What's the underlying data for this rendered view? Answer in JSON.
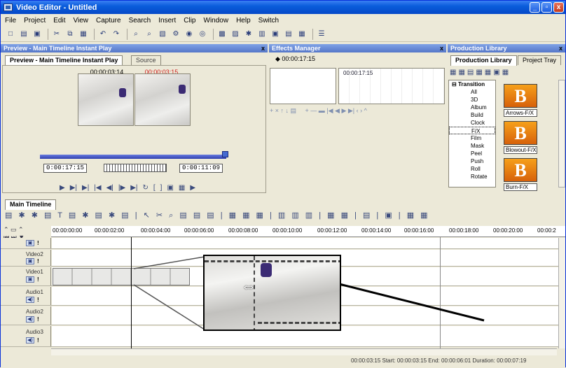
{
  "window": {
    "title": "Video Editor - Untitled",
    "min": "_",
    "max": "▫",
    "close": "x"
  },
  "menu": [
    "File",
    "Project",
    "Edit",
    "View",
    "Capture",
    "Search",
    "Insert",
    "Clip",
    "Window",
    "Help",
    "Switch"
  ],
  "toolbar_icons": [
    "new-icon",
    "open-icon",
    "save-icon",
    "cut-icon",
    "copy-icon",
    "paste-icon",
    "undo-icon",
    "redo-icon",
    "zoom-in-icon",
    "zoom-out-icon",
    "snapshot-icon",
    "settings-icon",
    "record-icon",
    "burn-icon",
    "preview-icon",
    "capture-icon",
    "effects-icon",
    "produce-icon",
    "library-icon",
    "layout-icon",
    "timeline-icon"
  ],
  "preview": {
    "panel_title": "Preview - Main Timeline Instant Play",
    "tab_active": "Preview - Main Timeline Instant Play",
    "tab_source": "Source",
    "time_left": "00:00:03:14",
    "time_right": "00:00:03:15",
    "timecode_in": "0:00:17:15",
    "timecode_out": "0:00:11:09",
    "close": "x"
  },
  "effects": {
    "panel_title": "Effects Manager",
    "time": "00:00:17:15",
    "ruler_time": "00:00:17:15",
    "close": "x"
  },
  "library": {
    "panel_title": "Production Library",
    "tab_active": "Production Library",
    "tab_other": "Project Tray",
    "close": "x",
    "tree_root": "Transition",
    "categories": [
      "All",
      "3D",
      "Album",
      "Build",
      "Clock",
      "F/X",
      "Film",
      "Mask",
      "Peel",
      "Push",
      "Roll",
      "Rotate"
    ],
    "items": [
      "Arrows-F/X",
      "Blowout-F/X",
      "Burn-F/X"
    ],
    "thumb_letter": "B",
    "accent": "#e07a10"
  },
  "timeline": {
    "tab": "Main Timeline",
    "ruler": [
      "00:00:00:00",
      "00:00:02:00",
      "00:00:04:00",
      "00:00:06:00",
      "00:00:08:00",
      "00:00:10:00",
      "00:00:12:00",
      "00:00:14:00",
      "00:00:16:00",
      "00:00:18:00",
      "00:00:20:00",
      "00:00:2"
    ],
    "tracks": [
      "Video2",
      "Video1",
      "Audio1",
      "Audio2",
      "Audio3"
    ],
    "status": "00:00:03:15   Start: 00:00:03:15   End: 00:00:06:01   Duration: 00:00:07:19"
  }
}
